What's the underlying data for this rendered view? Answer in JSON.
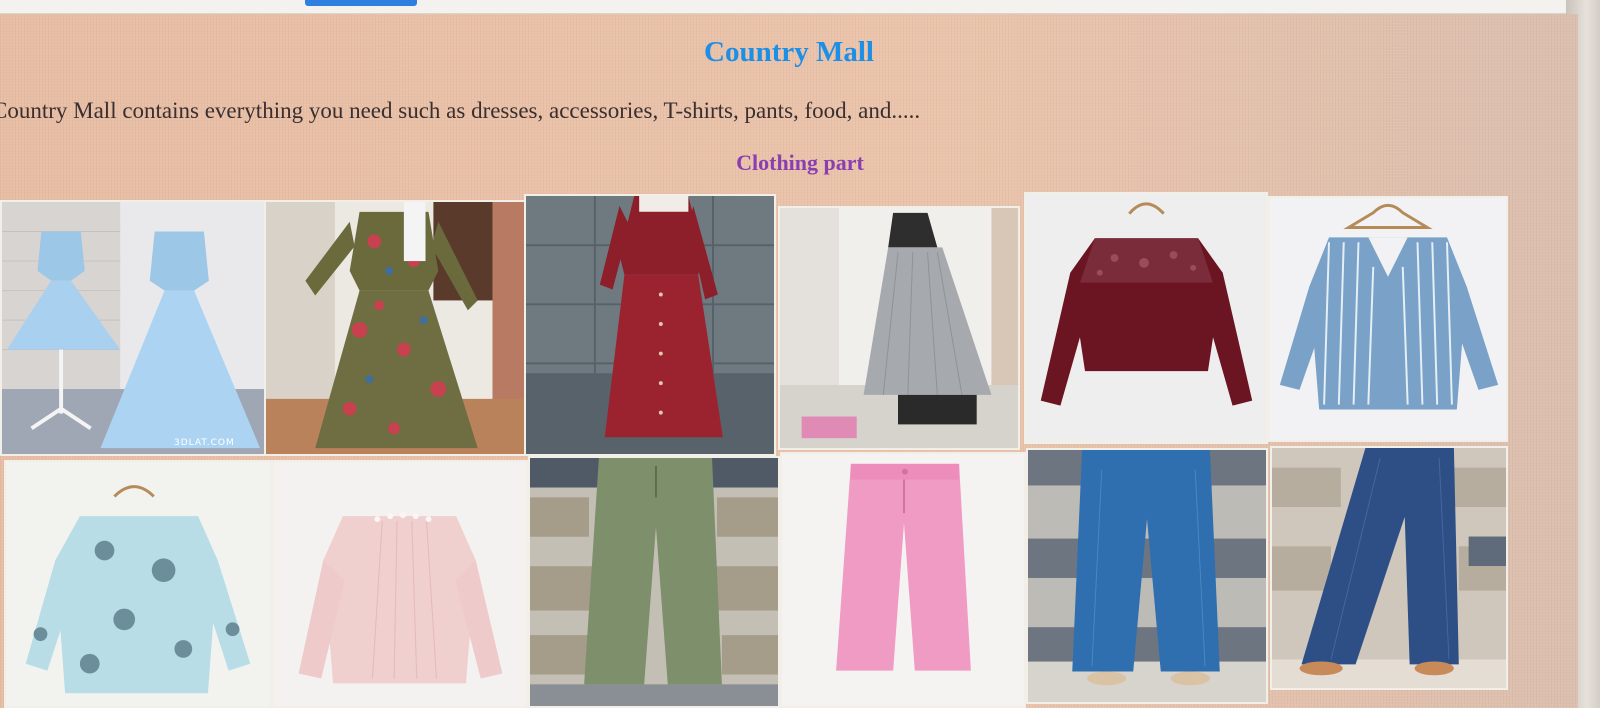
{
  "page": {
    "title": "Country Mall",
    "description": "Country Mall contains everything you need such as dresses, accessories, T-shirts, pants, food, and.....",
    "section_heading": "Clothing part"
  },
  "products": [
    {
      "name": "blue-tulle-dresses-image",
      "watermark": "3DLAT.COM"
    },
    {
      "name": "olive-floral-maxi-dress-image"
    },
    {
      "name": "burgundy-button-dress-image"
    },
    {
      "name": "grey-striped-shirt-dress-image"
    },
    {
      "name": "burgundy-lace-blouse-image"
    },
    {
      "name": "blue-striped-blouse-image"
    },
    {
      "name": "floral-light-blue-blouse-image"
    },
    {
      "name": "pale-pink-blouse-image"
    },
    {
      "name": "olive-wide-leg-pants-image"
    },
    {
      "name": "pink-wide-leg-pants-image"
    },
    {
      "name": "blue-wide-jeans-image"
    },
    {
      "name": "dark-blue-wide-jeans-image"
    }
  ],
  "colors": {
    "title": "#1e8fe6",
    "section_heading": "#8a3fb0",
    "background": "#e9bfa6"
  }
}
